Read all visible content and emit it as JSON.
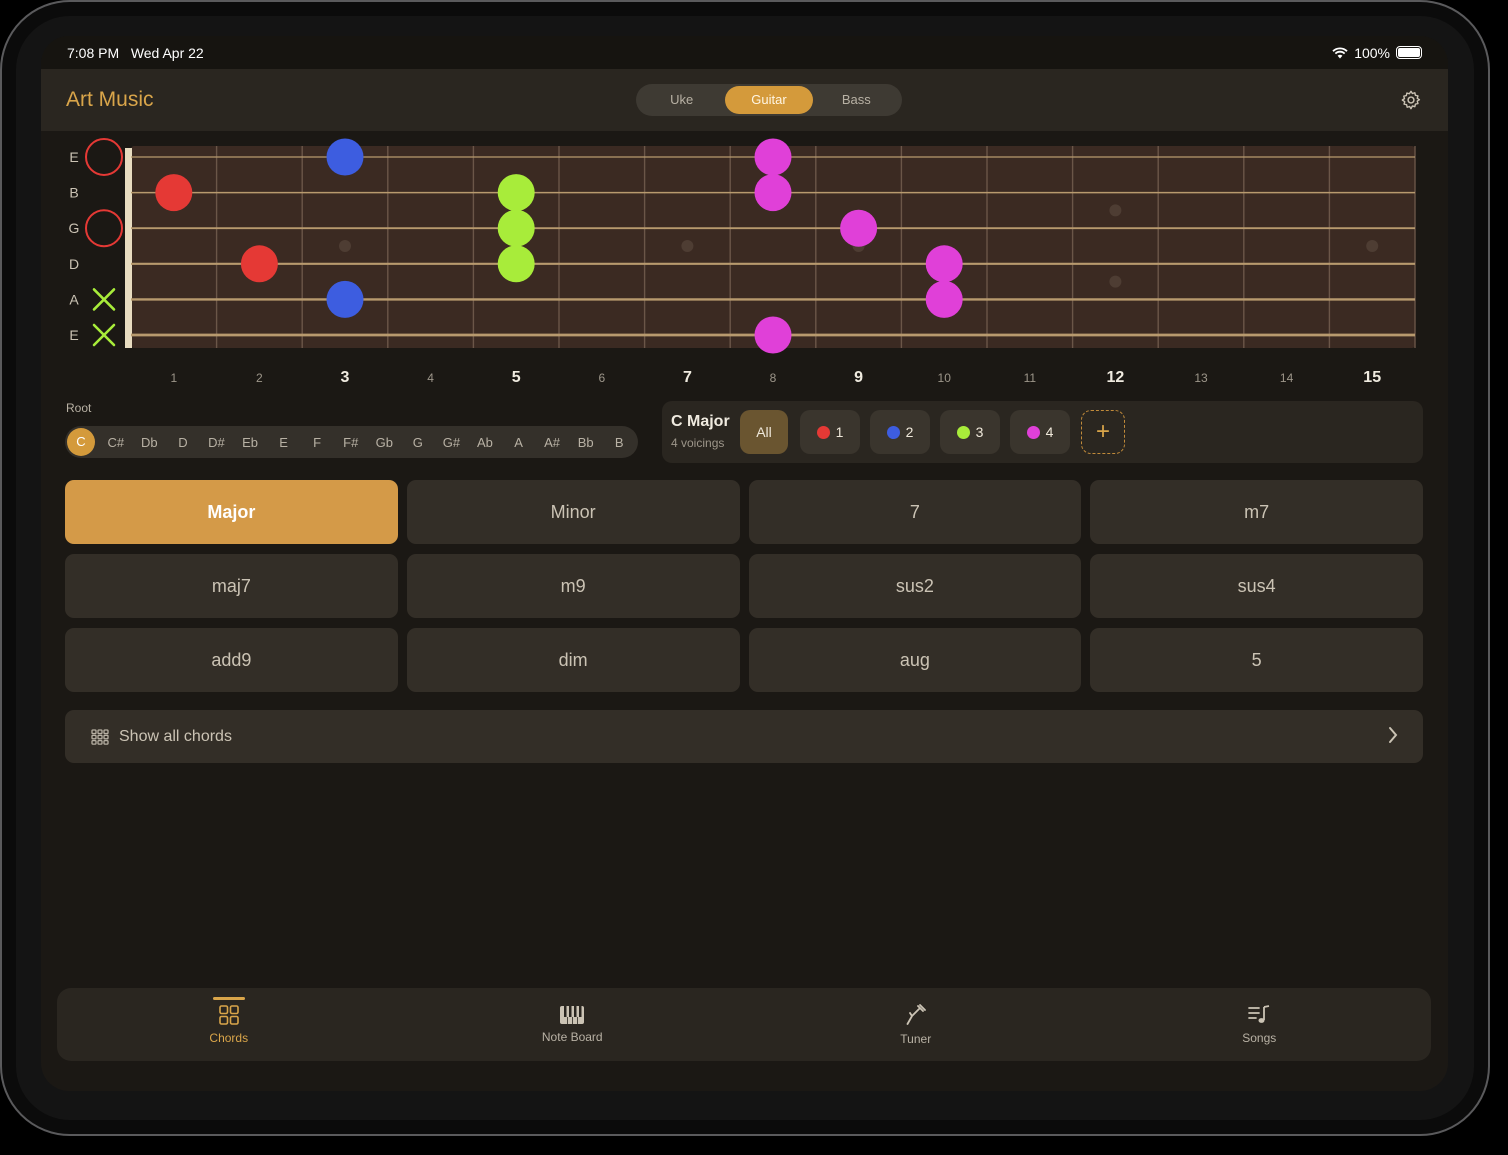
{
  "status": {
    "time": "7:08 PM",
    "date": "Wed Apr 22",
    "battery": "100%"
  },
  "header": {
    "title": "Art Music",
    "instruments": [
      "Uke",
      "Guitar",
      "Bass"
    ],
    "selected_instrument": "Guitar"
  },
  "fretboard": {
    "strings": [
      "E",
      "B",
      "G",
      "D",
      "A",
      "E"
    ],
    "open_markers": [
      "open",
      "",
      "open",
      "",
      "muted",
      "muted"
    ],
    "fret_numbers": [
      "1",
      "2",
      "3",
      "4",
      "5",
      "6",
      "7",
      "8",
      "9",
      "10",
      "11",
      "12",
      "13",
      "14",
      "15"
    ],
    "bold_frets": [
      3,
      5,
      7,
      9,
      12,
      15
    ],
    "inlays": [
      3,
      5,
      7,
      9,
      12,
      15
    ],
    "dots": [
      {
        "string": 0,
        "fret": 3,
        "voicing": 2
      },
      {
        "string": 4,
        "fret": 3,
        "voicing": 2
      },
      {
        "string": 1,
        "fret": 1,
        "voicing": 1
      },
      {
        "string": 3,
        "fret": 2,
        "voicing": 1
      },
      {
        "string": 1,
        "fret": 5,
        "voicing": 3
      },
      {
        "string": 2,
        "fret": 5,
        "voicing": 3
      },
      {
        "string": 3,
        "fret": 5,
        "voicing": 3
      },
      {
        "string": 0,
        "fret": 8,
        "voicing": 4
      },
      {
        "string": 1,
        "fret": 8,
        "voicing": 4
      },
      {
        "string": 5,
        "fret": 8,
        "voicing": 4
      },
      {
        "string": 2,
        "fret": 9,
        "voicing": 4
      },
      {
        "string": 3,
        "fret": 10,
        "voicing": 4
      },
      {
        "string": 4,
        "fret": 10,
        "voicing": 4
      }
    ],
    "voicing_colors": {
      "1": "#e53935",
      "2": "#3d5de0",
      "3": "#a8ec3a",
      "4": "#e040d8"
    }
  },
  "root": {
    "label": "Root",
    "notes": [
      "C",
      "C#",
      "Db",
      "D",
      "D#",
      "Eb",
      "E",
      "F",
      "F#",
      "Gb",
      "G",
      "G#",
      "Ab",
      "A",
      "A#",
      "Bb",
      "B"
    ],
    "selected": "C"
  },
  "voicings": {
    "title": "C Major",
    "subtitle": "4 voicings",
    "all_label": "All",
    "items": [
      "1",
      "2",
      "3",
      "4"
    ],
    "add_label": "+"
  },
  "chord_types": [
    "Major",
    "Minor",
    "7",
    "m7",
    "maj7",
    "m9",
    "sus2",
    "sus4",
    "add9",
    "dim",
    "aug",
    "5"
  ],
  "selected_chord_type": "Major",
  "show_all": {
    "label": "Show all chords"
  },
  "tabs": [
    {
      "label": "Chords",
      "icon": "grid-icon"
    },
    {
      "label": "Note Board",
      "icon": "piano-icon"
    },
    {
      "label": "Tuner",
      "icon": "tuning-fork-icon"
    },
    {
      "label": "Songs",
      "icon": "music-list-icon"
    }
  ],
  "active_tab": "Chords",
  "colors": {
    "accent": "#d49a3b",
    "background": "#1b1814",
    "fretboard": "#3b2a22"
  }
}
